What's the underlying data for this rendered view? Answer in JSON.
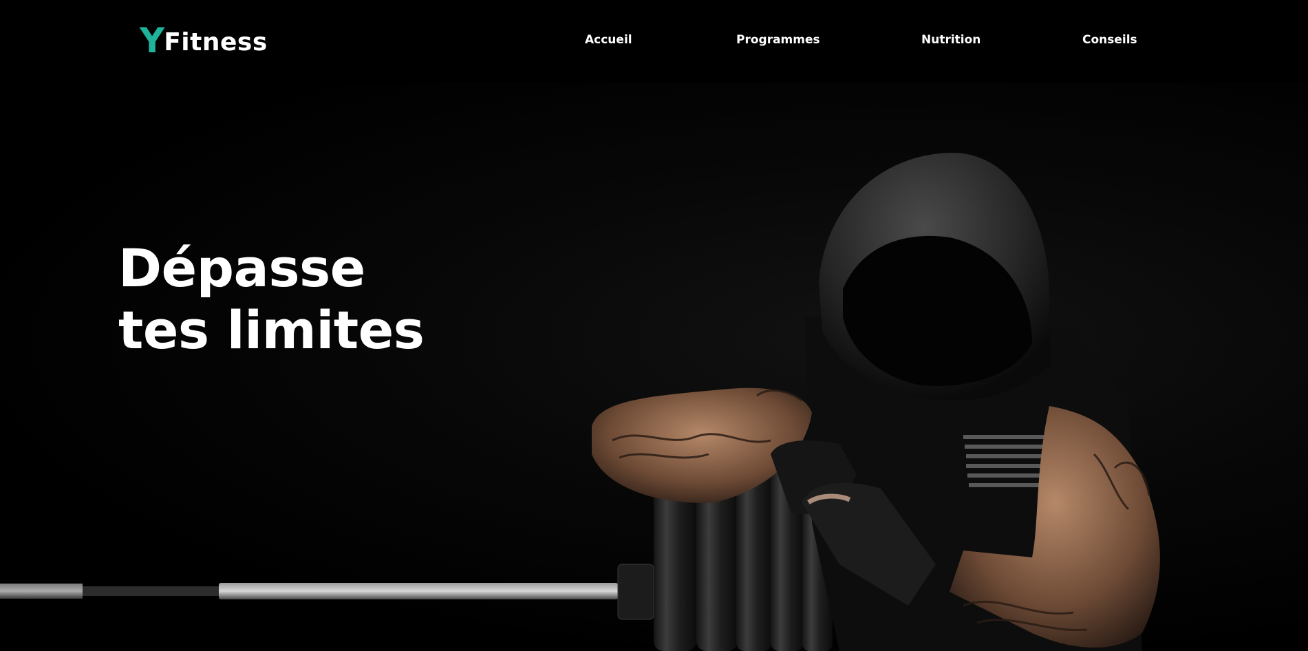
{
  "brand": {
    "letter": "Y",
    "name": "Fitness",
    "accent_color": "#1fb39c"
  },
  "nav": {
    "items": [
      {
        "label": "Accueil"
      },
      {
        "label": "Programmes"
      },
      {
        "label": "Nutrition"
      },
      {
        "label": "Conseils"
      }
    ]
  },
  "hero": {
    "title_line1": "Dépasse",
    "title_line2": "tes limites",
    "image": "hooded-athlete-leaning-on-barbell-plates"
  }
}
